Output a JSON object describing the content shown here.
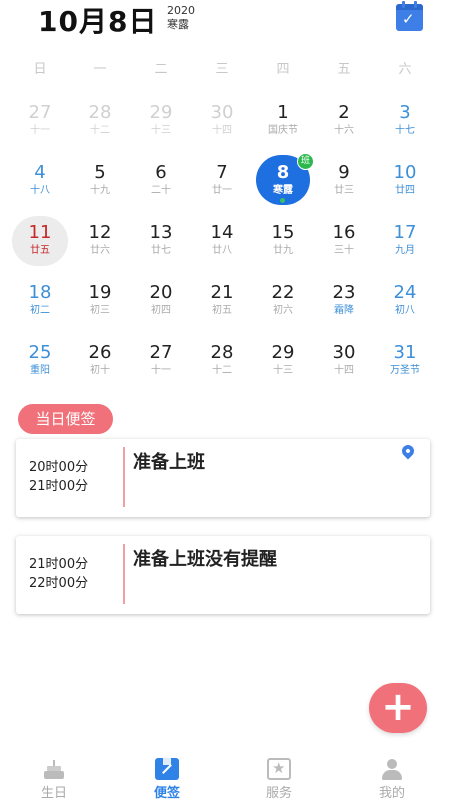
{
  "header": {
    "date": "10月8日",
    "year": "2020",
    "solar_term": "寒露"
  },
  "weekdays": [
    "日",
    "一",
    "二",
    "三",
    "四",
    "五",
    "六"
  ],
  "calendar": [
    [
      {
        "day": "27",
        "lunar": "十一",
        "type": "prev"
      },
      {
        "day": "28",
        "lunar": "十二",
        "type": "prev"
      },
      {
        "day": "29",
        "lunar": "十三",
        "type": "prev"
      },
      {
        "day": "30",
        "lunar": "十四",
        "type": "prev"
      },
      {
        "day": "1",
        "lunar": "国庆节",
        "type": "normal"
      },
      {
        "day": "2",
        "lunar": "十六",
        "type": "normal"
      },
      {
        "day": "3",
        "lunar": "十七",
        "type": "weekend"
      }
    ],
    [
      {
        "day": "4",
        "lunar": "十八",
        "type": "weekend"
      },
      {
        "day": "5",
        "lunar": "十九",
        "type": "normal"
      },
      {
        "day": "6",
        "lunar": "二十",
        "type": "normal"
      },
      {
        "day": "7",
        "lunar": "廿一",
        "type": "normal"
      },
      {
        "day": "8",
        "lunar": "寒露",
        "type": "selected",
        "badge": "班"
      },
      {
        "day": "9",
        "lunar": "廿三",
        "type": "normal"
      },
      {
        "day": "10",
        "lunar": "廿四",
        "type": "weekend"
      }
    ],
    [
      {
        "day": "11",
        "lunar": "廿五",
        "type": "today"
      },
      {
        "day": "12",
        "lunar": "廿六",
        "type": "normal"
      },
      {
        "day": "13",
        "lunar": "廿七",
        "type": "normal"
      },
      {
        "day": "14",
        "lunar": "廿八",
        "type": "normal"
      },
      {
        "day": "15",
        "lunar": "廿九",
        "type": "normal"
      },
      {
        "day": "16",
        "lunar": "三十",
        "type": "normal"
      },
      {
        "day": "17",
        "lunar": "九月",
        "type": "weekend"
      }
    ],
    [
      {
        "day": "18",
        "lunar": "初二",
        "type": "weekend"
      },
      {
        "day": "19",
        "lunar": "初三",
        "type": "normal"
      },
      {
        "day": "20",
        "lunar": "初四",
        "type": "normal"
      },
      {
        "day": "21",
        "lunar": "初五",
        "type": "normal"
      },
      {
        "day": "22",
        "lunar": "初六",
        "type": "normal"
      },
      {
        "day": "23",
        "lunar": "霜降",
        "type": "festival"
      },
      {
        "day": "24",
        "lunar": "初八",
        "type": "weekend"
      }
    ],
    [
      {
        "day": "25",
        "lunar": "重阳",
        "type": "weekend"
      },
      {
        "day": "26",
        "lunar": "初十",
        "type": "normal"
      },
      {
        "day": "27",
        "lunar": "十一",
        "type": "normal"
      },
      {
        "day": "28",
        "lunar": "十二",
        "type": "normal"
      },
      {
        "day": "29",
        "lunar": "十三",
        "type": "normal"
      },
      {
        "day": "30",
        "lunar": "十四",
        "type": "normal"
      },
      {
        "day": "31",
        "lunar": "万圣节",
        "type": "weekend"
      }
    ]
  ],
  "notes_tag": "当日便签",
  "notes": [
    {
      "start": "20时00分",
      "end": "21时00分",
      "title": "准备上班",
      "has_location": true
    },
    {
      "start": "21时00分",
      "end": "22时00分",
      "title": "准备上班没有提醒",
      "has_location": false
    }
  ],
  "fab_icon": "plus-icon",
  "nav": [
    {
      "label": "生日",
      "icon": "cake-icon",
      "active": false
    },
    {
      "label": "便签",
      "icon": "note-icon",
      "active": true
    },
    {
      "label": "服务",
      "icon": "star-service-icon",
      "active": false
    },
    {
      "label": "我的",
      "icon": "user-icon",
      "active": false
    }
  ],
  "colors": {
    "accent_blue": "#1e6fe0",
    "weekend_blue": "#3d8fd8",
    "pink": "#f0717a",
    "today_red": "#c62828",
    "badge_green": "#2db84d"
  }
}
